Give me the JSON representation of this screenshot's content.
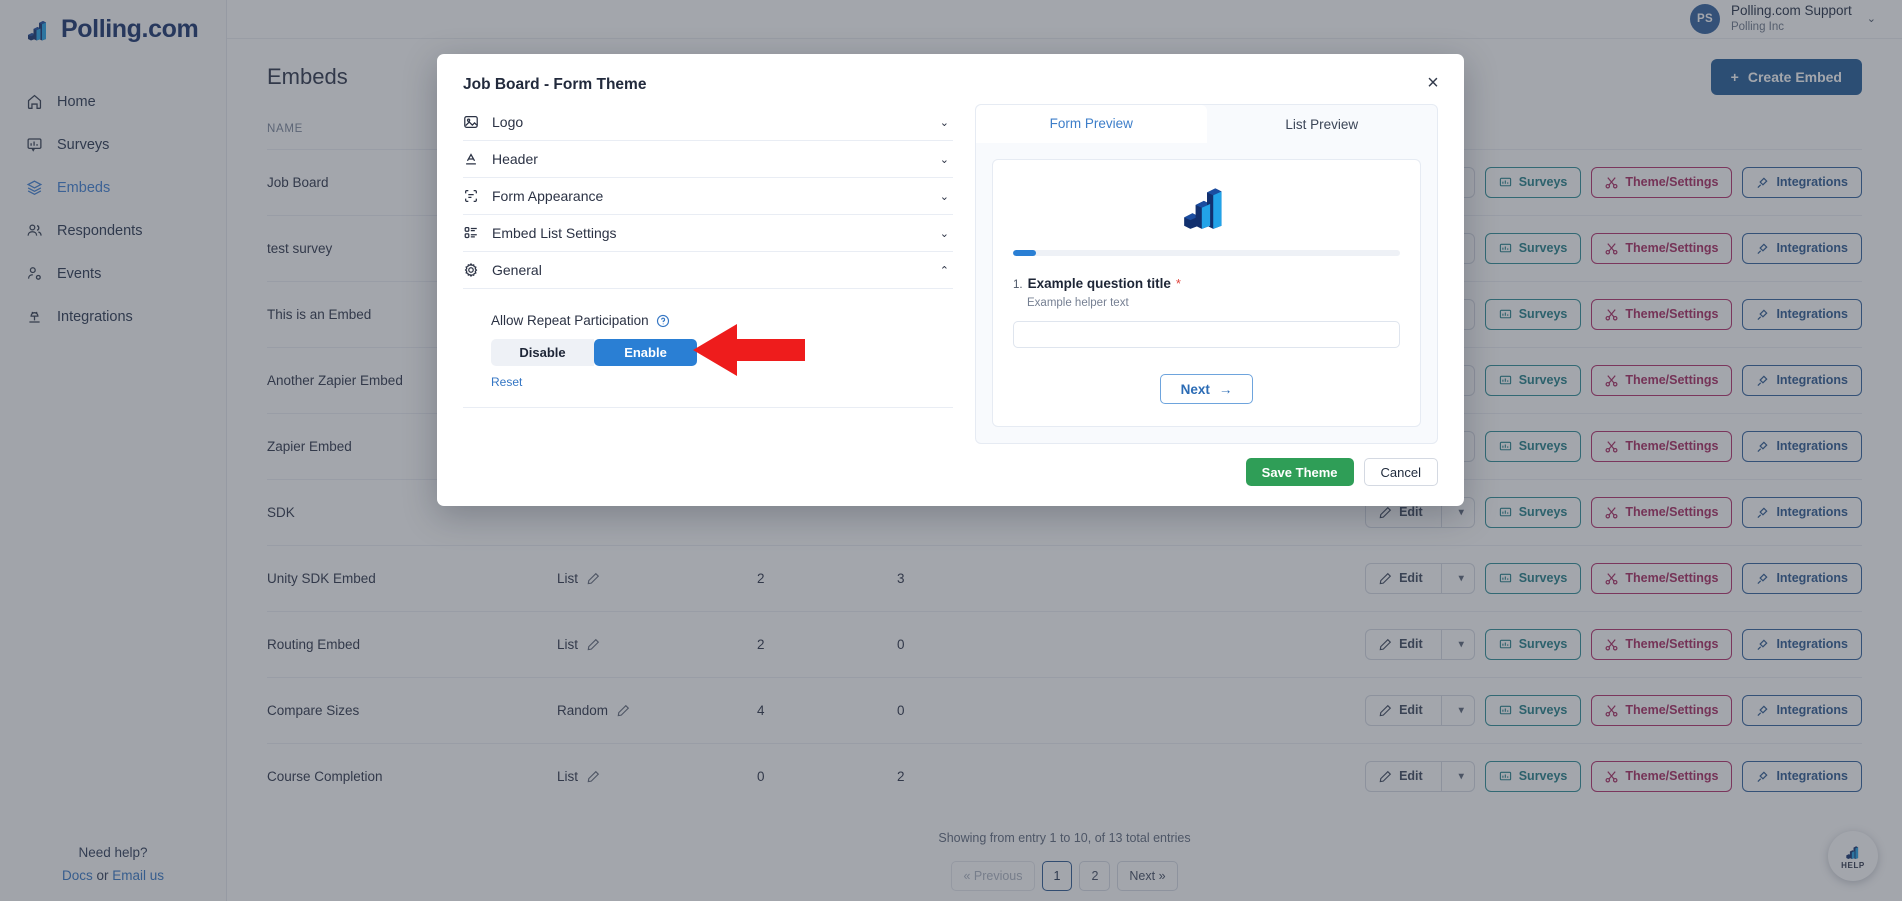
{
  "sidebar": {
    "brand": "Polling.com",
    "items": [
      {
        "label": "Home",
        "icon": "home-icon",
        "active": false
      },
      {
        "label": "Surveys",
        "icon": "survey-icon",
        "active": false
      },
      {
        "label": "Embeds",
        "icon": "layers-icon",
        "active": true
      },
      {
        "label": "Respondents",
        "icon": "users-icon",
        "active": false
      },
      {
        "label": "Events",
        "icon": "user-activity-icon",
        "active": false
      },
      {
        "label": "Integrations",
        "icon": "plug-icon",
        "active": false
      }
    ],
    "help": {
      "title": "Need help?",
      "docs": "Docs",
      "or": " or ",
      "email": "Email us"
    }
  },
  "topbar": {
    "avatar_initials": "PS",
    "user_name": "Polling.com Support",
    "user_org": "Polling Inc",
    "caret": "⌄"
  },
  "page": {
    "title": "Embeds",
    "create_button": "Create Embed",
    "create_plus": "+"
  },
  "table": {
    "columns": [
      "NAME",
      "",
      "",
      "",
      ""
    ],
    "rows": [
      {
        "name": "Job Board",
        "type": "",
        "n1": "",
        "n2": ""
      },
      {
        "name": "test survey",
        "type": "",
        "n1": "",
        "n2": ""
      },
      {
        "name": "This is an Embed",
        "type": "",
        "n1": "",
        "n2": ""
      },
      {
        "name": "Another Zapier Embed",
        "type": "",
        "n1": "",
        "n2": ""
      },
      {
        "name": "Zapier Embed",
        "type": "",
        "n1": "",
        "n2": ""
      },
      {
        "name": "SDK",
        "type": "",
        "n1": "",
        "n2": ""
      },
      {
        "name": "Unity SDK Embed",
        "type": "List",
        "n1": "2",
        "n2": "3"
      },
      {
        "name": "Routing Embed",
        "type": "List",
        "n1": "2",
        "n2": "0"
      },
      {
        "name": "Compare Sizes",
        "type": "Random",
        "n1": "4",
        "n2": "0"
      },
      {
        "name": "Course Completion",
        "type": "List",
        "n1": "0",
        "n2": "2"
      }
    ],
    "actions": {
      "edit": "Edit",
      "surveys": "Surveys",
      "theme_settings": "Theme/Settings",
      "integrations": "Integrations"
    }
  },
  "footer": {
    "showing": "Showing from entry 1 to 10, of 13 total entries",
    "pager": [
      {
        "label": "« Previous",
        "state": "disabled"
      },
      {
        "label": "1",
        "state": "current"
      },
      {
        "label": "2",
        "state": "normal"
      },
      {
        "label": "Next »",
        "state": "normal"
      }
    ]
  },
  "help_fab": {
    "label": "HELP"
  },
  "modal": {
    "title": "Job Board - Form Theme",
    "close": "×",
    "sections": [
      {
        "label": "Logo",
        "icon": "image-icon",
        "expanded": false,
        "chevron": "⌄"
      },
      {
        "label": "Header",
        "icon": "text-format-icon",
        "expanded": false,
        "chevron": "⌄"
      },
      {
        "label": "Form Appearance",
        "icon": "form-scan-icon",
        "expanded": false,
        "chevron": "⌄"
      },
      {
        "label": "Embed List Settings",
        "icon": "list-settings-icon",
        "expanded": false,
        "chevron": "⌄"
      },
      {
        "label": "General",
        "icon": "gear-icon",
        "expanded": true,
        "chevron": "⌃"
      }
    ],
    "general": {
      "field_label": "Allow Repeat Participation",
      "disable": "Disable",
      "enable": "Enable",
      "selected": "Enable",
      "reset": "Reset"
    },
    "preview": {
      "tabs": [
        {
          "label": "Form Preview",
          "active": true
        },
        {
          "label": "List Preview",
          "active": false
        }
      ],
      "progress_percent": 6,
      "question_number": "1.",
      "question_title": "Example question title",
      "required_mark": "*",
      "helper_text": "Example helper text",
      "answer_value": "",
      "next_label": "Next",
      "next_arrow": "→"
    },
    "footer": {
      "save": "Save Theme",
      "cancel": "Cancel"
    }
  },
  "colors": {
    "brand_navy": "#15306b",
    "accent_blue": "#2a7fd4",
    "save_green": "#2f9e57",
    "theme_magenta": "#a8275f",
    "surveys_teal": "#1f7d86",
    "arrow_red": "#ee1c1c"
  }
}
